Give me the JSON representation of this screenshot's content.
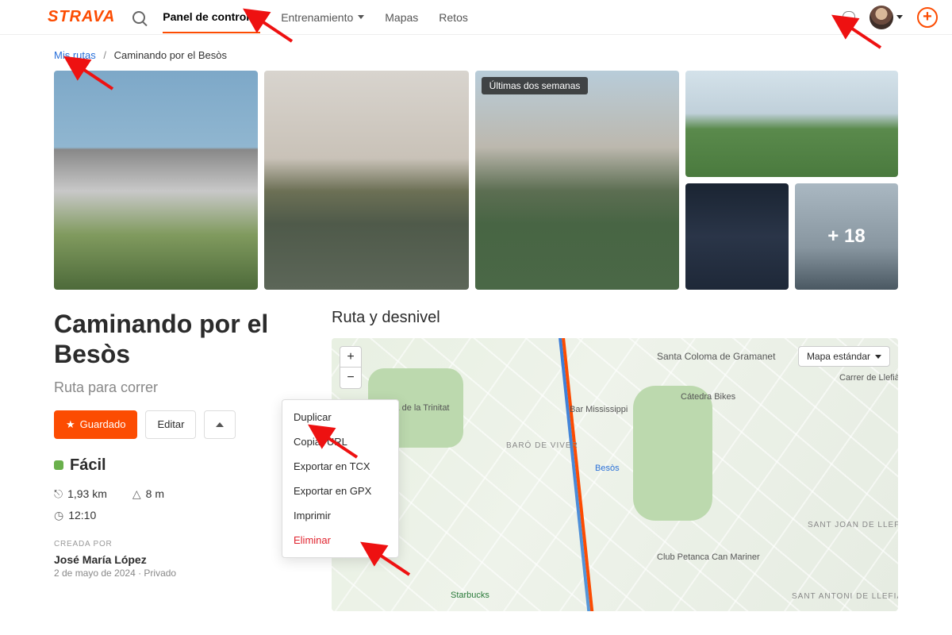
{
  "nav": {
    "logo": "STRAVA",
    "items": [
      {
        "label": "Panel de control",
        "active": true,
        "chevron": true
      },
      {
        "label": "Entrenamiento",
        "active": false,
        "chevron": true
      },
      {
        "label": "Mapas",
        "active": false,
        "chevron": false
      },
      {
        "label": "Retos",
        "active": false,
        "chevron": false
      }
    ],
    "plus": "+"
  },
  "breadcrumb": {
    "root": "Mis rutas",
    "sep": "/",
    "current": "Caminando por el Besòs"
  },
  "photos": {
    "badge": "Últimas dos semanas",
    "more": "+ 18"
  },
  "route": {
    "title": "Caminando por el Besòs",
    "subtitle": "Ruta para correr",
    "buttons": {
      "saved": "Guardado",
      "edit": "Editar"
    },
    "difficulty": "Fácil",
    "stats": {
      "distance": "1,93 km",
      "elevation": "8 m",
      "time": "12:10"
    },
    "created_label": "CREADA POR",
    "created_name": "José María López",
    "created_meta": "2 de mayo de 2024  ·  Privado"
  },
  "dropdown": {
    "duplicate": "Duplicar",
    "copy_url": "Copiar URL",
    "export_tcx": "Exportar en TCX",
    "export_gpx": "Exportar en GPX",
    "print": "Imprimir",
    "delete": "Eliminar"
  },
  "map": {
    "section": "Ruta y desnivel",
    "type_label": "Mapa estándar",
    "labels": {
      "trinitat": "Plaça de la Trinitat",
      "mississippi": "Bar Mississippi",
      "baro": "BARÓ DE VIVER",
      "besos": "Besòs",
      "catedra": "Cátedra Bikes",
      "stacoloma": "Santa Coloma de Gramanet",
      "llefia": "Carrer de Llefià",
      "starbucks": "Starbucks",
      "petanca": "Club Petanca Can Mariner",
      "santjoan": "SANT JOAN DE LLEFIÀ",
      "santantoni": "SANT ANTONI DE LLEFIÀ"
    }
  }
}
